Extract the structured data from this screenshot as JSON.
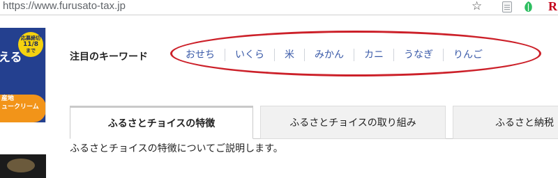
{
  "browser": {
    "url": "https://www.furusato-tax.jp",
    "ext_r_label": "R"
  },
  "banner": {
    "text": "える",
    "badge_line1": "応募締切",
    "badge_line2": "11/8",
    "badge_line3": "まで",
    "orange_line1": "産地",
    "orange_line2": "ュークリーム"
  },
  "keywords": {
    "label": "注目のキーワード",
    "items": [
      "おせち",
      "いくら",
      "米",
      "みかん",
      "カニ",
      "うなぎ",
      "りんご"
    ]
  },
  "tabs": [
    {
      "label": "ふるさとチョイスの特徴"
    },
    {
      "label": "ふるさとチョイスの取り組み"
    },
    {
      "label": "ふるさと納税"
    }
  ],
  "description": "ふるさとチョイスの特徴についてご説明します。"
}
